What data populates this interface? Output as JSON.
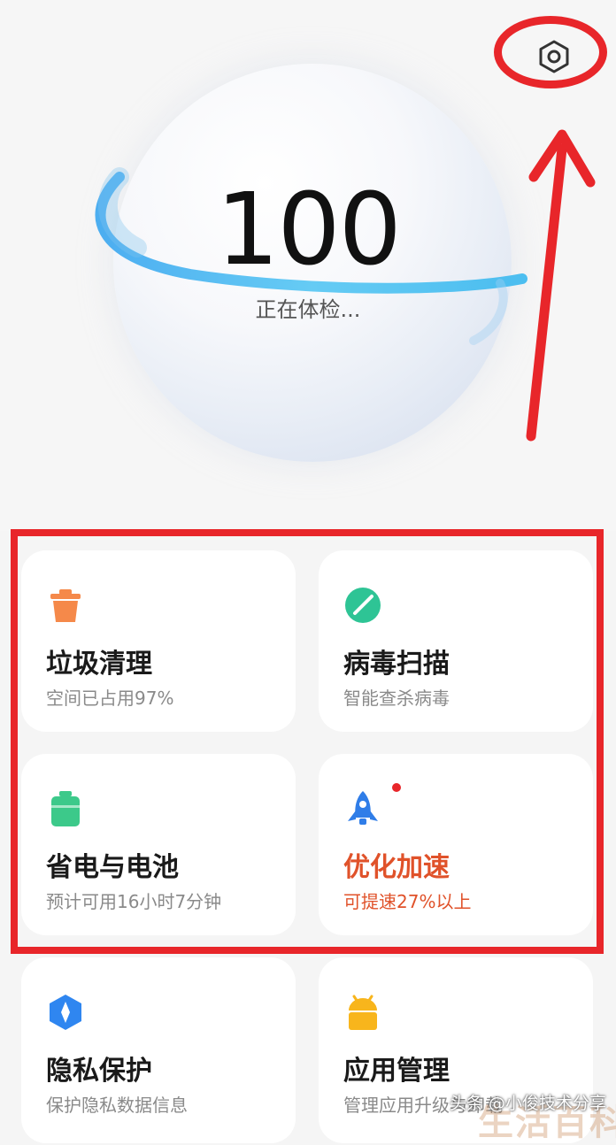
{
  "health": {
    "score": "100",
    "status": "正在体检..."
  },
  "header": {
    "settings_icon": "settings-hexagon-icon"
  },
  "cards": [
    {
      "icon": "trash-icon",
      "icon_color": "#f5894a",
      "title": "垃圾清理",
      "subtitle": "空间已占用97%"
    },
    {
      "icon": "virus-scan-icon",
      "icon_color": "#2ec495",
      "title": "病毒扫描",
      "subtitle": "智能查杀病毒"
    },
    {
      "icon": "battery-icon",
      "icon_color": "#3cc98a",
      "title": "省电与电池",
      "subtitle": "预计可用16小时7分钟"
    },
    {
      "icon": "rocket-icon",
      "icon_color": "#2f7de8",
      "title": "优化加速",
      "subtitle": "可提速27%以上",
      "accent_color": "#e0522a",
      "badge": true
    },
    {
      "icon": "privacy-shield-icon",
      "icon_color": "#2f86f0",
      "title": "隐私保护",
      "subtitle": "保护隐私数据信息"
    },
    {
      "icon": "android-app-icon",
      "icon_color": "#f8b51c",
      "title": "应用管理",
      "subtitle": "管理应用升级与卸载"
    }
  ],
  "watermark": {
    "text": "头条 @小俊技术分享",
    "overlay_text": "生活百科"
  },
  "annotation_color": "#e8262a"
}
